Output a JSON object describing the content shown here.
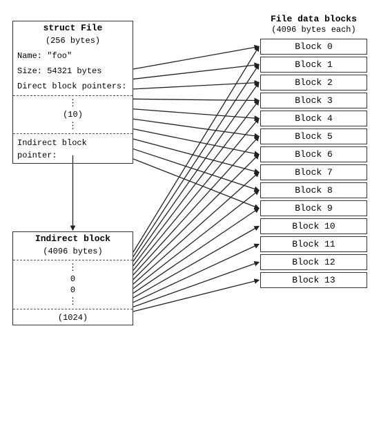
{
  "struct_file": {
    "title": "struct File",
    "subtitle": "(256 bytes)",
    "name_row": "Name: \"foo\"",
    "size_row": "Size: 54321 bytes",
    "direct_label": "Direct block pointers:",
    "dots1": "⋮",
    "num_direct": "(10)",
    "dots2": "⋮",
    "indirect_label": "Indirect block pointer:"
  },
  "indirect_block": {
    "title": "Indirect block",
    "subtitle": "(4096 bytes)",
    "dots1": "⋮",
    "val1": "0",
    "val2": "0",
    "dots2": "⋮",
    "num": "(1024)"
  },
  "file_data_blocks": {
    "title": "File data blocks",
    "subtitle": "(4096 bytes each)",
    "blocks": [
      "Block 0",
      "Block 1",
      "Block 2",
      "Block 3",
      "Block 4",
      "Block 5",
      "Block 6",
      "Block 7",
      "Block 8",
      "Block 9",
      "Block 10",
      "Block 11",
      "Block 12",
      "Block 13"
    ]
  }
}
